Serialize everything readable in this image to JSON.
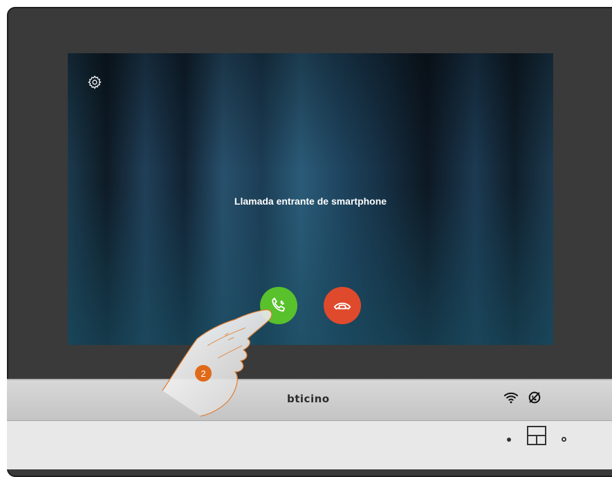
{
  "screen": {
    "message": "Llamada entrante de smartphone",
    "settings_icon": "gear-icon",
    "answer_icon": "phone-answer-icon",
    "hangup_icon": "phone-hangup-icon",
    "answer_color": "#58c12c",
    "hangup_color": "#e04a2c"
  },
  "bezel": {
    "brand": "bticino",
    "status_icons": [
      "wifi-icon",
      "no-ring-icon"
    ]
  },
  "annotation": {
    "step_number": "2"
  }
}
